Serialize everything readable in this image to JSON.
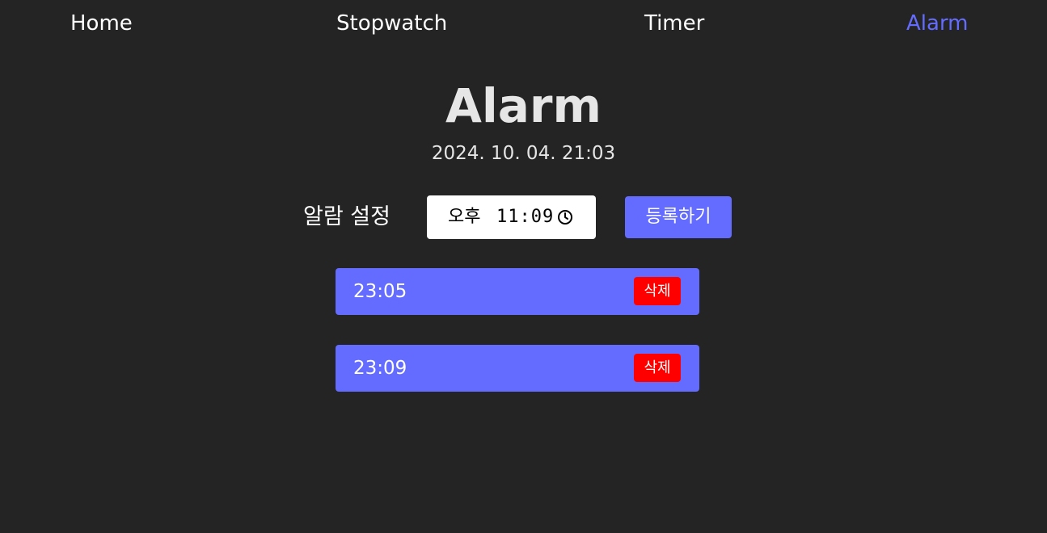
{
  "nav": {
    "items": [
      {
        "label": "Home"
      },
      {
        "label": "Stopwatch"
      },
      {
        "label": "Timer"
      },
      {
        "label": "Alarm",
        "active": true
      }
    ],
    "active_color": "#646cff"
  },
  "page": {
    "title": "Alarm",
    "current_datetime": "2024. 10. 04. 21:03"
  },
  "alarm_form": {
    "label": "알람 설정",
    "time_input": {
      "ampm": "오후",
      "value": "11:09",
      "icon": "clock-icon"
    },
    "register_label": "등록하기"
  },
  "alarms": [
    {
      "time": "23:05",
      "delete_label": "삭제"
    },
    {
      "time": "23:09",
      "delete_label": "삭제"
    }
  ],
  "colors": {
    "background": "#242424",
    "accent": "#646cff",
    "delete": "#ff0000"
  }
}
